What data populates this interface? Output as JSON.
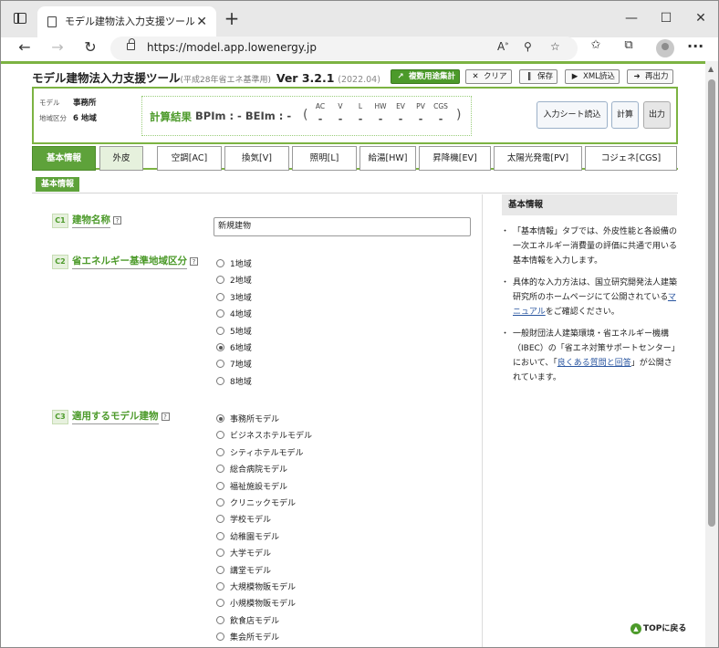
{
  "browser": {
    "tab_title": "モデル建物法入力支援ツール (平成...",
    "tab_close": "✕",
    "new_tab": "+",
    "window_controls": {
      "minimize": "—",
      "maximize": "☐",
      "close": "✕"
    },
    "url": "https://model.app.lowenergy.jp",
    "toolbar_icons": [
      "read-aloud-icon",
      "zoom-icon",
      "favorite-add-icon",
      "favorites-icon",
      "collections-icon",
      "profile-icon",
      "more-icon"
    ]
  },
  "app": {
    "title": "モデル建物法入力支援ツール",
    "subtitle": "(平成28年省エネ基準用)",
    "version": "Ver 3.2.1",
    "date": "(2022.04)",
    "buttons": {
      "multi_use": "複数用途集計",
      "clear": "クリア",
      "save": "保存",
      "xml_load": "XML読込",
      "reoutput": "再出力"
    }
  },
  "summary": {
    "model_label": "モデル",
    "model_value": "事務所",
    "region_label": "地域区分",
    "region_value": "6 地域",
    "calc_title": "計算結果",
    "bpim": "BPIm : -",
    "beim": "BEIm : -",
    "open_paren": "(",
    "close_paren": ")",
    "categories": [
      {
        "label": "AC",
        "value": "-"
      },
      {
        "label": "V",
        "value": "-"
      },
      {
        "label": "L",
        "value": "-"
      },
      {
        "label": "HW",
        "value": "-"
      },
      {
        "label": "EV",
        "value": "-"
      },
      {
        "label": "PV",
        "value": "-"
      },
      {
        "label": "CGS",
        "value": "-"
      }
    ],
    "btn_input_sheet": "入力シート読込",
    "btn_calc": "計算",
    "btn_output": "出力"
  },
  "tabs": [
    "基本情報",
    "外皮",
    "空調[AC]",
    "換気[V]",
    "照明[L]",
    "給湯[HW]",
    "昇降機[EV]",
    "太陽光発電[PV]",
    "コジェネ[CGS]"
  ],
  "section_label": "基本情報",
  "questions": {
    "c1": {
      "num": "C1",
      "label": "建物名称",
      "help": "?",
      "value": "新規建物"
    },
    "c2": {
      "num": "C2",
      "label": "省エネルギー基準地域区分",
      "help": "?",
      "options": [
        "1地域",
        "2地域",
        "3地域",
        "4地域",
        "5地域",
        "6地域",
        "7地域",
        "8地域"
      ],
      "selected": "6地域"
    },
    "c3": {
      "num": "C3",
      "label": "適用するモデル建物",
      "help": "?",
      "options": [
        "事務所モデル",
        "ビジネスホテルモデル",
        "シティホテルモデル",
        "総合病院モデル",
        "福祉施設モデル",
        "クリニックモデル",
        "学校モデル",
        "幼稚園モデル",
        "大学モデル",
        "講堂モデル",
        "大規模物販モデル",
        "小規模物販モデル",
        "飲食店モデル",
        "集会所モデル"
      ],
      "selected": "事務所モデル"
    }
  },
  "sidebar": {
    "heading": "基本情報",
    "p1": "「基本情報」タブでは、外皮性能と各設備の一次エネルギー消費量の評価に共通で用いる基本情報を入力します。",
    "p2_pre": "具体的な入力方法は、国立研究開発法人建築研究所のホームページにて公開されている",
    "p2_link": "マニュアル",
    "p2_post": "をご確認ください。",
    "p3_pre": "一般財団法人建築環境・省エネルギー機構（IBEC）の「省エネ対策サポートセンター」において、「",
    "p3_link": "良くある質問と回答",
    "p3_post": "」が公開されています。"
  },
  "top_link": "TOPに戻る"
}
